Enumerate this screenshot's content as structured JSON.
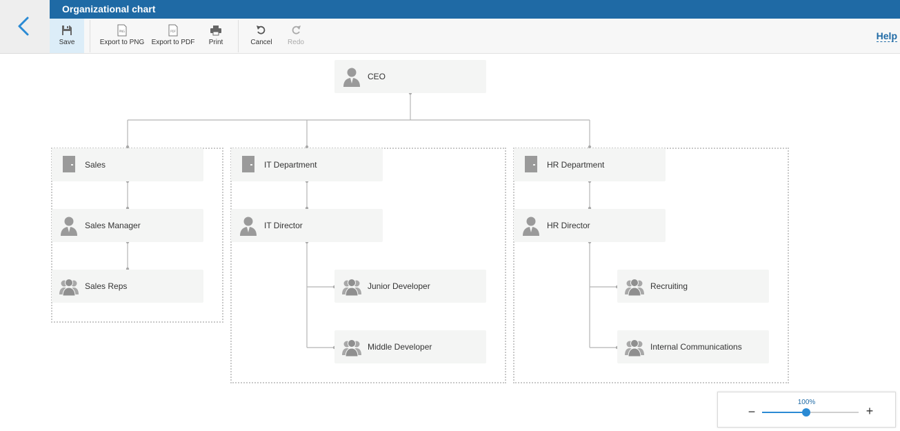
{
  "header": {
    "title": "Organizational chart",
    "help_label": "Help"
  },
  "toolbar": {
    "save_label": "Save",
    "export_png_label": "Export to PNG",
    "export_pdf_label": "Export to PDF",
    "print_label": "Print",
    "cancel_label": "Cancel",
    "redo_label": "Redo"
  },
  "chart": {
    "ceo": {
      "label": "CEO",
      "icon": "person-icon"
    },
    "sales": {
      "department": {
        "label": "Sales",
        "icon": "building-icon"
      },
      "manager": {
        "label": "Sales Manager",
        "icon": "person-icon"
      },
      "team": {
        "label": "Sales Reps",
        "icon": "group-icon"
      }
    },
    "it": {
      "department": {
        "label": "IT Department",
        "icon": "building-icon"
      },
      "director": {
        "label": "IT Director",
        "icon": "person-icon"
      },
      "teams": [
        {
          "label": "Junior Developer",
          "icon": "group-icon"
        },
        {
          "label": "Middle Developer",
          "icon": "group-icon"
        }
      ]
    },
    "hr": {
      "department": {
        "label": "HR Department",
        "icon": "building-icon"
      },
      "director": {
        "label": "HR Director",
        "icon": "person-icon"
      },
      "teams": [
        {
          "label": "Recruiting",
          "icon": "group-icon"
        },
        {
          "label": "Internal Communications",
          "icon": "group-icon"
        }
      ]
    }
  },
  "zoom": {
    "label": "100%",
    "level": 0.46,
    "minus": "−",
    "plus": "+"
  },
  "colors": {
    "accent": "#1f6aa5",
    "slider": "#2a8ad4",
    "node_bg": "#f4f5f4",
    "icon": "#9a9a9a"
  }
}
